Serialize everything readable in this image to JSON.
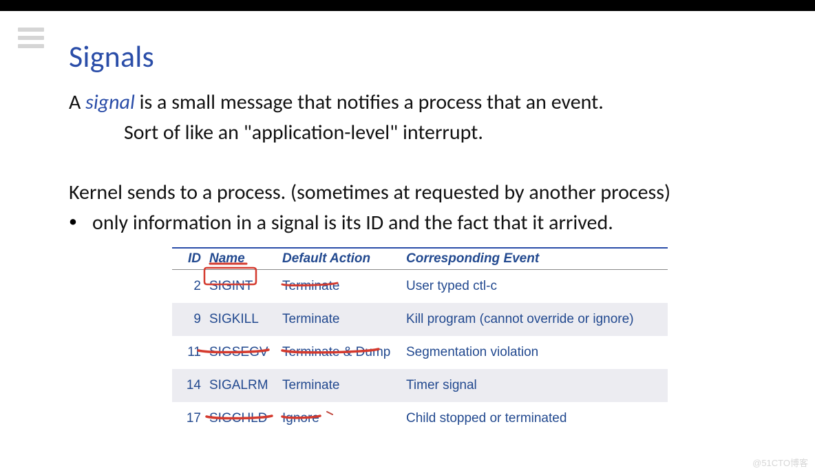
{
  "title": "Signals",
  "intro": {
    "pre": "A ",
    "term": "signal",
    "post": " is a small message that notifies a process that an event.",
    "sub": "Sort of like an \"application-level\" interrupt."
  },
  "kernel_line": "Kernel sends to a process. (sometimes at requested by another process)",
  "bullet": "only information in a signal is its ID and the fact that it arrived.",
  "table": {
    "headers": {
      "id": "ID",
      "name": "Name",
      "action": "Default Action",
      "event": "Corresponding Event"
    },
    "rows": [
      {
        "id": "2",
        "name": "SIGINT",
        "action": "Terminate",
        "event": "User typed ctl-c"
      },
      {
        "id": "9",
        "name": "SIGKILL",
        "action": "Terminate",
        "event": "Kill program (cannot override or ignore)"
      },
      {
        "id": "11",
        "name": "SIGSEGV",
        "action": "Terminate & Dump",
        "event": "Segmentation violation"
      },
      {
        "id": "14",
        "name": "SIGALRM",
        "action": "Terminate",
        "event": "Timer signal"
      },
      {
        "id": "17",
        "name": "SIGCHLD",
        "action": "Ignore",
        "event": "Child stopped or terminated"
      }
    ]
  },
  "watermark": "@51CTO博客"
}
